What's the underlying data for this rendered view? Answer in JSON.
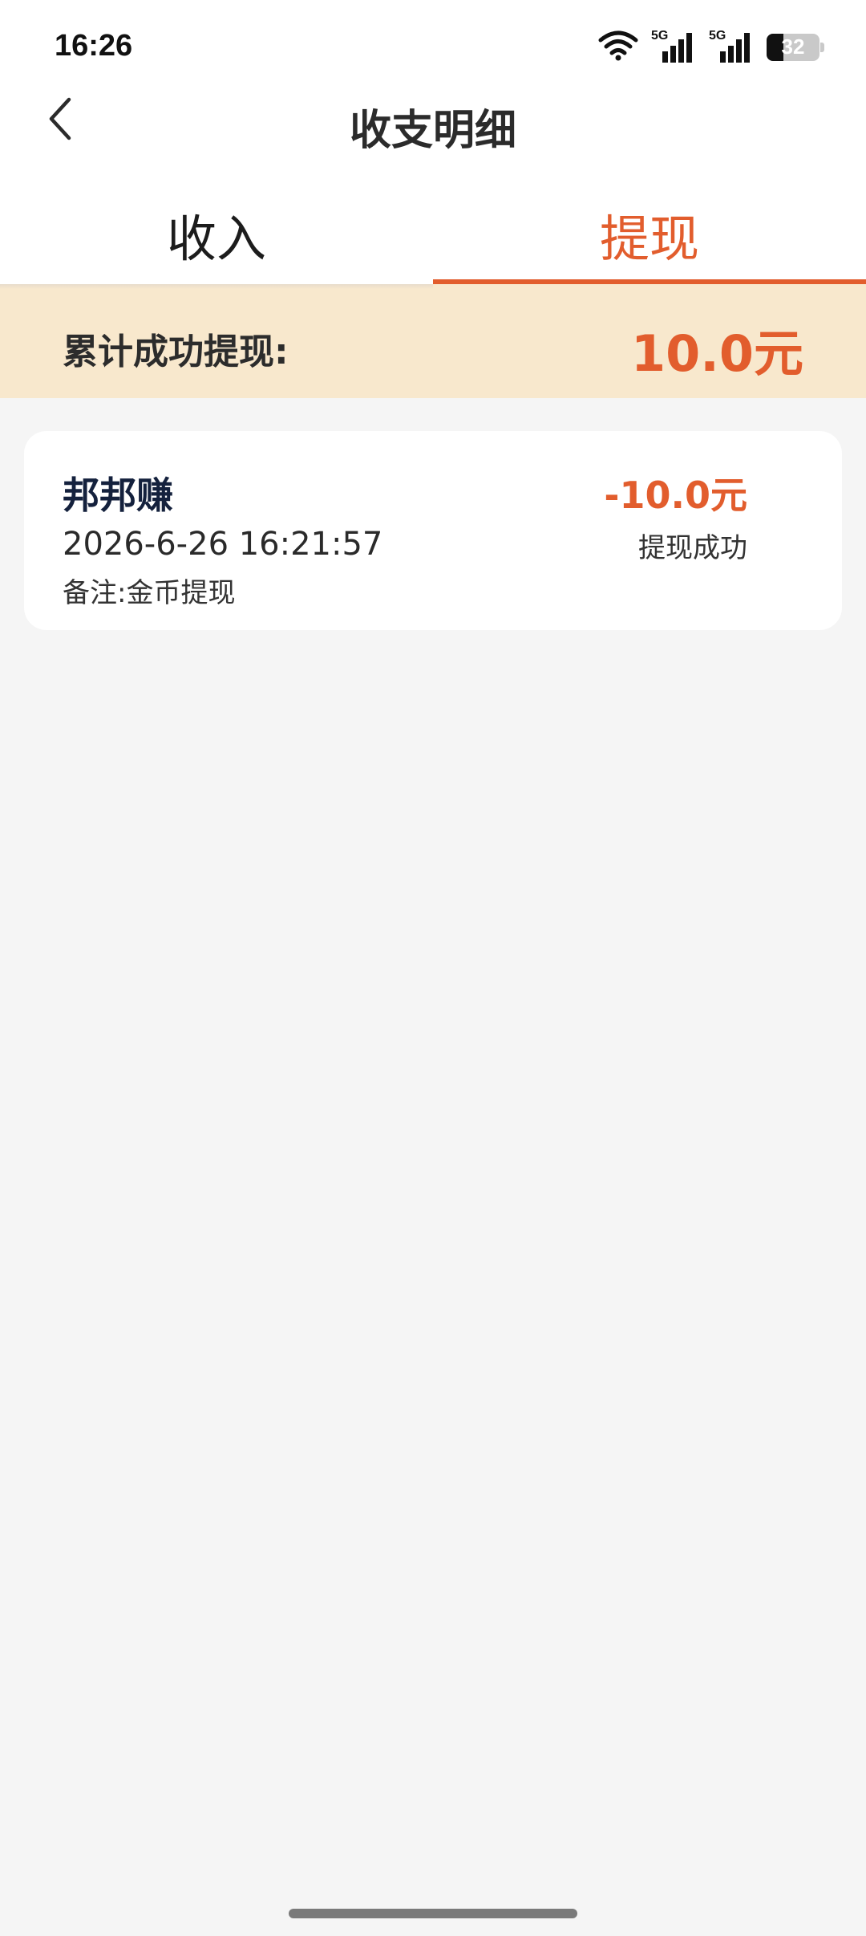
{
  "status_bar": {
    "time": "16:26",
    "network_1": "5G",
    "network_2": "5G",
    "battery_level": "32"
  },
  "header": {
    "title": "收支明细"
  },
  "tabs": [
    {
      "label": "收入",
      "active": false
    },
    {
      "label": "提现",
      "active": true
    }
  ],
  "summary": {
    "label": "累计成功提现:",
    "amount": "10.0元"
  },
  "records": [
    {
      "name": "邦邦赚",
      "time": "2026-6-26 16:21:57",
      "note": "备注:金币提现",
      "amount": "-10.0元",
      "status": "提现成功"
    }
  ],
  "colors": {
    "accent": "#e25d2d",
    "banner_bg": "#f8e8cd",
    "page_bg": "#f5f5f5"
  },
  "icons": {
    "back": "chevron-left-icon",
    "wifi": "wifi-icon",
    "signal": "signal-icon",
    "battery": "battery-icon"
  }
}
